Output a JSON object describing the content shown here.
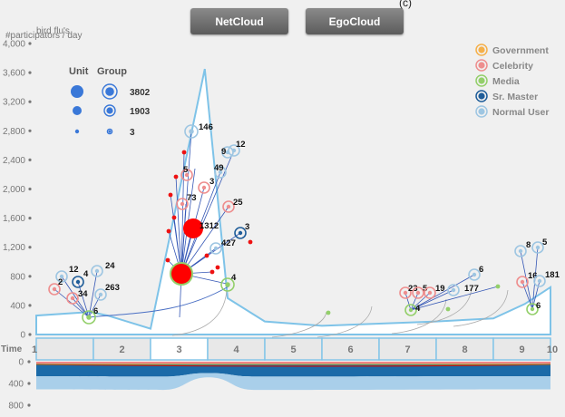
{
  "tabs": {
    "net": "NetCloud",
    "ego": "EgoCloud"
  },
  "top_mark": "(c)",
  "legend": [
    {
      "label": "Government",
      "color": "#f5b04a"
    },
    {
      "label": "Celebrity",
      "color": "#ee8e8e"
    },
    {
      "label": "Media",
      "color": "#93cf6a"
    },
    {
      "label": "Sr. Master",
      "color": "#1f5d99"
    },
    {
      "label": "Normal User",
      "color": "#9ec6e2"
    }
  ],
  "size_legend": {
    "unit_header": "Unit",
    "group_header": "Group",
    "values": [
      "3802",
      "1903",
      "3"
    ]
  },
  "chart_data": {
    "type": "area",
    "title": "bird flu's",
    "ylabel": "#participators / day",
    "xlabel": "Time",
    "ylim": [
      0,
      4000
    ],
    "yticks": [
      "4,000",
      "3,600",
      "3,200",
      "2,800",
      "2,400",
      "2,000",
      "1,600",
      "1,200",
      "800",
      "400",
      "0"
    ],
    "ytick_values": [
      4000,
      3600,
      3200,
      2800,
      2400,
      2000,
      1600,
      1200,
      800,
      400,
      0
    ],
    "x_ticks": [
      "1",
      "2",
      "3",
      "4",
      "5",
      "6",
      "7",
      "8",
      "9",
      "10"
    ],
    "x_range": [
      1,
      10
    ],
    "highlighted_day": "3",
    "series": [
      {
        "x": [
          1,
          1.95,
          2.25,
          3.0,
          3.95,
          4.35,
          5.0,
          6.0,
          7.0,
          8.0,
          9.0,
          9.55,
          10.0
        ],
        "values": [
          260,
          310,
          260,
          80,
          3650,
          500,
          180,
          120,
          150,
          180,
          220,
          420,
          650
        ]
      }
    ],
    "node_labels": [
      "12",
      "4",
      "24",
      "2",
      "34",
      "263",
      "6",
      "146",
      "12",
      "9",
      "5",
      "49",
      "3",
      "73",
      "25",
      "1312",
      "3",
      "427",
      "4",
      "23",
      "5",
      "19",
      "177",
      "6",
      "4",
      "8",
      "5",
      "16",
      "181",
      "6"
    ],
    "bottom_ticks": [
      "0",
      "400",
      "800"
    ],
    "bottom_ylim": [
      0,
      800
    ],
    "bottom_bands": [
      {
        "name": "Celebrity",
        "color": "#f08585",
        "values": [
          40,
          40,
          40,
          40,
          40
        ]
      },
      {
        "name": "Media",
        "color": "#a9d46e",
        "values": [
          10,
          10,
          10,
          10,
          10
        ]
      },
      {
        "name": "Government",
        "color": "#f0c35a",
        "values": [
          8,
          8,
          8,
          8,
          8
        ]
      },
      {
        "name": "Sr. Master",
        "color": "#1b6aa8",
        "values": [
          210,
          215,
          150,
          215,
          210
        ]
      },
      {
        "name": "Normal User",
        "color": "#a9cfea",
        "values": [
          240,
          245,
          80,
          245,
          240
        ]
      }
    ]
  }
}
